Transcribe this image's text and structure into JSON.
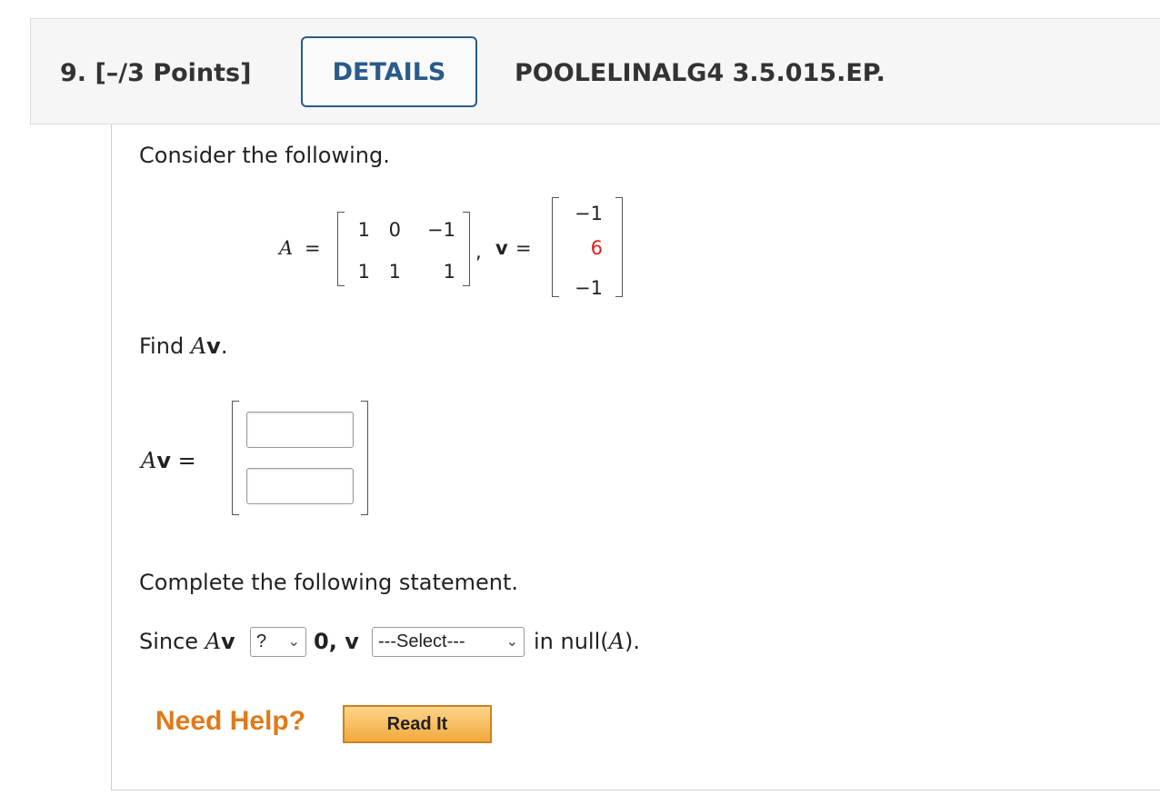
{
  "header": {
    "question_number": "9.",
    "points": "[–/3 Points]",
    "details_label": "DETAILS",
    "problem_code": "POOLELINALG4 3.5.015.EP."
  },
  "problem": {
    "intro": "Consider the following.",
    "matrix_label": "A",
    "equals": "=",
    "matrix_A": [
      [
        "1",
        "0",
        "−1"
      ],
      [
        "1",
        "1",
        "1"
      ]
    ],
    "comma": ",",
    "vector_label": "v",
    "vector_v": [
      "−1",
      "6",
      "−1"
    ],
    "find_prefix": "Find ",
    "find_A": "A",
    "find_v": "v",
    "find_suffix": ".",
    "answer_label_A": "A",
    "answer_label_v": "v",
    "answer_equals": "="
  },
  "statement": {
    "prompt": "Complete the following statement.",
    "since": "Since ",
    "A": "A",
    "v": "v",
    "select1_value": "?",
    "zero": "0,",
    "v2": "v",
    "select2_value": "---Select---",
    "in_null_prefix": "in null(",
    "in_null_A": "A",
    "in_null_suffix": ")."
  },
  "help": {
    "need_help": "Need Help?",
    "read_it": "Read It"
  },
  "colors": {
    "accent_blue": "#2a5b8a",
    "highlight_red": "#e02020",
    "help_orange": "#e07a1a"
  }
}
